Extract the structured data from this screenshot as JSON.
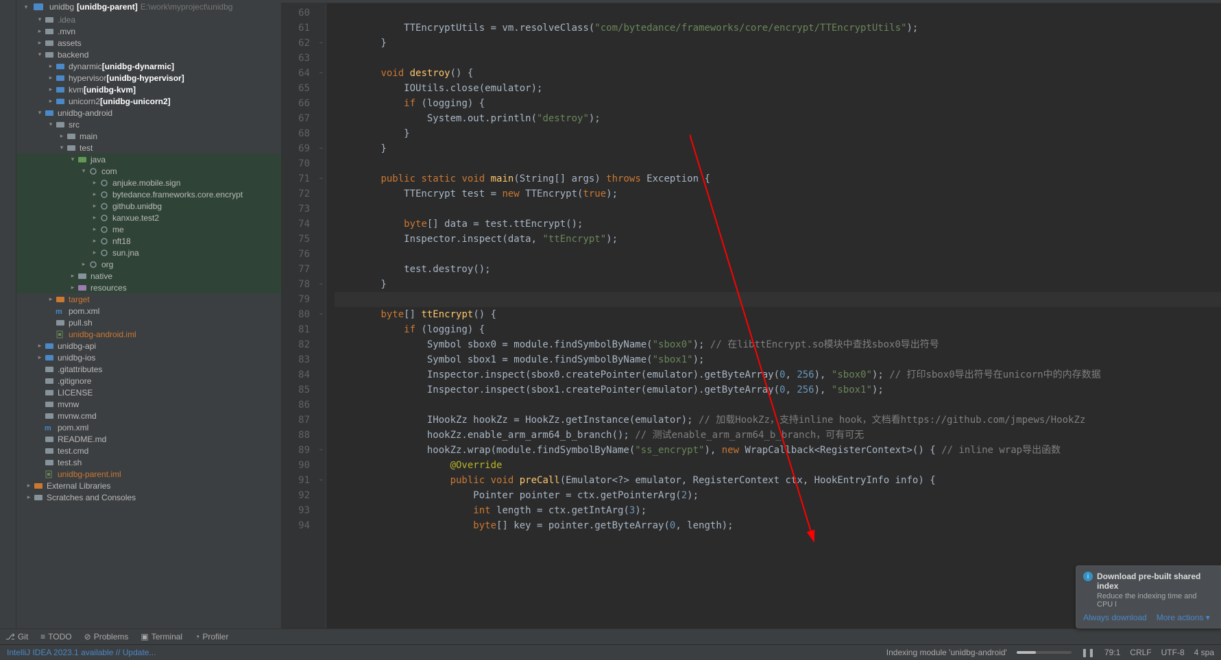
{
  "sidebar": {
    "root": "unidbg",
    "root_mod": "[unidbg-parent]",
    "root_path": "E:\\work\\myproject\\unidbg",
    "items": [
      {
        "d": 1,
        "exp": "▾",
        "ic": "folder",
        "label": ".idea",
        "dim": true
      },
      {
        "d": 1,
        "exp": "▸",
        "ic": "folder",
        "label": ".mvn"
      },
      {
        "d": 1,
        "exp": "▸",
        "ic": "folder",
        "label": "assets"
      },
      {
        "d": 1,
        "exp": "▾",
        "ic": "folder",
        "label": "backend"
      },
      {
        "d": 2,
        "exp": "▸",
        "ic": "mod",
        "label": "dynarmic",
        "mod": "[unidbg-dynarmic]"
      },
      {
        "d": 2,
        "exp": "▸",
        "ic": "mod",
        "label": "hypervisor",
        "mod": "[unidbg-hypervisor]"
      },
      {
        "d": 2,
        "exp": "▸",
        "ic": "mod",
        "label": "kvm",
        "mod": "[unidbg-kvm]"
      },
      {
        "d": 2,
        "exp": "▸",
        "ic": "mod",
        "label": "unicorn2",
        "mod": "[unidbg-unicorn2]"
      },
      {
        "d": 1,
        "exp": "▾",
        "ic": "mod",
        "label": "unidbg-android",
        "module": true
      },
      {
        "d": 2,
        "exp": "▾",
        "ic": "folder",
        "label": "src"
      },
      {
        "d": 3,
        "exp": "▸",
        "ic": "folder",
        "label": "main"
      },
      {
        "d": 3,
        "exp": "▾",
        "ic": "folder",
        "label": "test"
      },
      {
        "d": 4,
        "exp": "▾",
        "ic": "src",
        "label": "java",
        "sel": true
      },
      {
        "d": 5,
        "exp": "▾",
        "ic": "pkg",
        "label": "com",
        "sel": true
      },
      {
        "d": 6,
        "exp": "▸",
        "ic": "pkg",
        "label": "anjuke.mobile.sign",
        "sel": true
      },
      {
        "d": 6,
        "exp": "▸",
        "ic": "pkg",
        "label": "bytedance.frameworks.core.encrypt",
        "sel": true
      },
      {
        "d": 6,
        "exp": "▸",
        "ic": "pkg",
        "label": "github.unidbg",
        "sel": true
      },
      {
        "d": 6,
        "exp": "▸",
        "ic": "pkg",
        "label": "kanxue.test2",
        "sel": true
      },
      {
        "d": 6,
        "exp": "▸",
        "ic": "pkg",
        "label": "me",
        "sel": true
      },
      {
        "d": 6,
        "exp": "▸",
        "ic": "pkg",
        "label": "nft18",
        "sel": true
      },
      {
        "d": 6,
        "exp": "▸",
        "ic": "pkg",
        "label": "sun.jna",
        "sel": true
      },
      {
        "d": 5,
        "exp": "▸",
        "ic": "pkg",
        "label": "org",
        "sel": true
      },
      {
        "d": 4,
        "exp": "▸",
        "ic": "folder",
        "label": "native",
        "sel": true
      },
      {
        "d": 4,
        "exp": "▸",
        "ic": "res",
        "label": "resources",
        "sel": true
      },
      {
        "d": 2,
        "exp": "▸",
        "ic": "target",
        "label": "target",
        "orange": true
      },
      {
        "d": 2,
        "exp": "",
        "ic": "mvn",
        "label": "pom.xml"
      },
      {
        "d": 2,
        "exp": "",
        "ic": "file",
        "label": "pull.sh"
      },
      {
        "d": 2,
        "exp": "",
        "ic": "iml",
        "label": "unidbg-android.iml",
        "orange": true
      },
      {
        "d": 1,
        "exp": "▸",
        "ic": "mod",
        "label": "unidbg-api",
        "module": true
      },
      {
        "d": 1,
        "exp": "▸",
        "ic": "mod",
        "label": "unidbg-ios",
        "module": true
      },
      {
        "d": 1,
        "exp": "",
        "ic": "file",
        "label": ".gitattributes"
      },
      {
        "d": 1,
        "exp": "",
        "ic": "file",
        "label": ".gitignore"
      },
      {
        "d": 1,
        "exp": "",
        "ic": "file",
        "label": "LICENSE"
      },
      {
        "d": 1,
        "exp": "",
        "ic": "file",
        "label": "mvnw"
      },
      {
        "d": 1,
        "exp": "",
        "ic": "file",
        "label": "mvnw.cmd"
      },
      {
        "d": 1,
        "exp": "",
        "ic": "mvn",
        "label": "pom.xml"
      },
      {
        "d": 1,
        "exp": "",
        "ic": "file",
        "label": "README.md"
      },
      {
        "d": 1,
        "exp": "",
        "ic": "file",
        "label": "test.cmd"
      },
      {
        "d": 1,
        "exp": "",
        "ic": "file",
        "label": "test.sh"
      },
      {
        "d": 1,
        "exp": "",
        "ic": "iml",
        "label": "unidbg-parent.iml",
        "orange": true
      },
      {
        "d": 0,
        "exp": "▸",
        "ic": "lib",
        "label": "External Libraries"
      },
      {
        "d": 0,
        "exp": "▸",
        "ic": "scratch",
        "label": "Scratches and Consoles"
      }
    ]
  },
  "editor": {
    "first_line": 60,
    "lines": [
      {
        "n": 60,
        "t": []
      },
      {
        "n": 61,
        "t": [
          {
            "c": "ident",
            "s": "            TTEncryptUtils = vm.resolveClass("
          },
          {
            "c": "str",
            "s": "\"com/bytedance/frameworks/core/encrypt/TTEncryptUtils\""
          },
          {
            "c": "ident",
            "s": ");"
          }
        ]
      },
      {
        "n": 62,
        "fold": "−",
        "t": [
          {
            "c": "ident",
            "s": "        }"
          }
        ]
      },
      {
        "n": 63,
        "t": []
      },
      {
        "n": 64,
        "fold": "−",
        "t": [
          {
            "c": "ident",
            "s": "        "
          },
          {
            "c": "kw",
            "s": "void"
          },
          {
            "c": "ident",
            "s": " "
          },
          {
            "c": "fn",
            "s": "destroy"
          },
          {
            "c": "ident",
            "s": "() {"
          }
        ]
      },
      {
        "n": 65,
        "t": [
          {
            "c": "ident",
            "s": "            IOUtils.close(emulator);"
          }
        ]
      },
      {
        "n": 66,
        "t": [
          {
            "c": "ident",
            "s": "            "
          },
          {
            "c": "kw",
            "s": "if"
          },
          {
            "c": "ident",
            "s": " (logging) {"
          }
        ]
      },
      {
        "n": 67,
        "t": [
          {
            "c": "ident",
            "s": "                System.out.println("
          },
          {
            "c": "str",
            "s": "\"destroy\""
          },
          {
            "c": "ident",
            "s": ");"
          }
        ]
      },
      {
        "n": 68,
        "t": [
          {
            "c": "ident",
            "s": "            }"
          }
        ]
      },
      {
        "n": 69,
        "fold": "−",
        "t": [
          {
            "c": "ident",
            "s": "        }"
          }
        ]
      },
      {
        "n": 70,
        "t": []
      },
      {
        "n": 71,
        "fold": "−",
        "t": [
          {
            "c": "ident",
            "s": "        "
          },
          {
            "c": "kw",
            "s": "public static void"
          },
          {
            "c": "ident",
            "s": " "
          },
          {
            "c": "fn",
            "s": "main"
          },
          {
            "c": "ident",
            "s": "(String[] args) "
          },
          {
            "c": "kw",
            "s": "throws"
          },
          {
            "c": "ident",
            "s": " Exception {"
          }
        ]
      },
      {
        "n": 72,
        "t": [
          {
            "c": "ident",
            "s": "            TTEncrypt test = "
          },
          {
            "c": "kw",
            "s": "new"
          },
          {
            "c": "ident",
            "s": " TTEncrypt("
          },
          {
            "c": "kw",
            "s": "true"
          },
          {
            "c": "ident",
            "s": ");"
          }
        ]
      },
      {
        "n": 73,
        "t": []
      },
      {
        "n": 74,
        "t": [
          {
            "c": "ident",
            "s": "            "
          },
          {
            "c": "kw",
            "s": "byte"
          },
          {
            "c": "ident",
            "s": "[] data = test.ttEncrypt();"
          }
        ]
      },
      {
        "n": 75,
        "t": [
          {
            "c": "ident",
            "s": "            Inspector.inspect(data, "
          },
          {
            "c": "str",
            "s": "\"ttEncrypt\""
          },
          {
            "c": "ident",
            "s": ");"
          }
        ]
      },
      {
        "n": 76,
        "t": []
      },
      {
        "n": 77,
        "t": [
          {
            "c": "ident",
            "s": "            test.destroy();"
          }
        ]
      },
      {
        "n": 78,
        "fold": "−",
        "t": [
          {
            "c": "ident",
            "s": "        }"
          }
        ]
      },
      {
        "n": 79,
        "caret": true,
        "t": []
      },
      {
        "n": 80,
        "fold": "−",
        "t": [
          {
            "c": "ident",
            "s": "        "
          },
          {
            "c": "kw",
            "s": "byte"
          },
          {
            "c": "ident",
            "s": "[] "
          },
          {
            "c": "fn",
            "s": "ttEncrypt"
          },
          {
            "c": "ident",
            "s": "() {"
          }
        ]
      },
      {
        "n": 81,
        "t": [
          {
            "c": "ident",
            "s": "            "
          },
          {
            "c": "kw",
            "s": "if"
          },
          {
            "c": "ident",
            "s": " (logging) {"
          }
        ]
      },
      {
        "n": 82,
        "t": [
          {
            "c": "ident",
            "s": "                Symbol sbox0 = module.findSymbolByName("
          },
          {
            "c": "str",
            "s": "\"sbox0\""
          },
          {
            "c": "ident",
            "s": "); "
          },
          {
            "c": "com",
            "s": "// 在libttEncrypt.so模块中查找sbox0导出符号"
          }
        ]
      },
      {
        "n": 83,
        "t": [
          {
            "c": "ident",
            "s": "                Symbol sbox1 = module.findSymbolByName("
          },
          {
            "c": "str",
            "s": "\"sbox1\""
          },
          {
            "c": "ident",
            "s": ");"
          }
        ]
      },
      {
        "n": 84,
        "t": [
          {
            "c": "ident",
            "s": "                Inspector.inspect(sbox0.createPointer(emulator).getByteArray("
          },
          {
            "c": "num",
            "s": "0"
          },
          {
            "c": "ident",
            "s": ", "
          },
          {
            "c": "num",
            "s": "256"
          },
          {
            "c": "ident",
            "s": "), "
          },
          {
            "c": "str",
            "s": "\"sbox0\""
          },
          {
            "c": "ident",
            "s": "); "
          },
          {
            "c": "com",
            "s": "// 打印sbox0导出符号在unicorn中的内存数据"
          }
        ]
      },
      {
        "n": 85,
        "t": [
          {
            "c": "ident",
            "s": "                Inspector.inspect(sbox1.createPointer(emulator).getByteArray("
          },
          {
            "c": "num",
            "s": "0"
          },
          {
            "c": "ident",
            "s": ", "
          },
          {
            "c": "num",
            "s": "256"
          },
          {
            "c": "ident",
            "s": "), "
          },
          {
            "c": "str",
            "s": "\"sbox1\""
          },
          {
            "c": "ident",
            "s": ");"
          }
        ]
      },
      {
        "n": 86,
        "t": []
      },
      {
        "n": 87,
        "t": [
          {
            "c": "ident",
            "s": "                IHookZz hookZz = HookZz.getInstance(emulator); "
          },
          {
            "c": "com",
            "s": "// 加载HookZz，支持inline hook，文档看https://github.com/jmpews/HookZz"
          }
        ]
      },
      {
        "n": 88,
        "t": [
          {
            "c": "ident",
            "s": "                hookZz.enable_arm_arm64_b_branch(); "
          },
          {
            "c": "com",
            "s": "// 测试enable_arm_arm64_b_branch，可有可无"
          }
        ]
      },
      {
        "n": 89,
        "fold": "−",
        "t": [
          {
            "c": "ident",
            "s": "                hookZz.wrap(module.findSymbolByName("
          },
          {
            "c": "str",
            "s": "\"ss_encrypt\""
          },
          {
            "c": "ident",
            "s": "), "
          },
          {
            "c": "kw",
            "s": "new"
          },
          {
            "c": "ident",
            "s": " WrapCallback<RegisterContext>() { "
          },
          {
            "c": "com",
            "s": "// inline wrap导出函数"
          }
        ]
      },
      {
        "n": 90,
        "t": [
          {
            "c": "ident",
            "s": "                    "
          },
          {
            "c": "ann",
            "s": "@Override"
          }
        ]
      },
      {
        "n": 91,
        "fold": "−",
        "t": [
          {
            "c": "ident",
            "s": "                    "
          },
          {
            "c": "kw",
            "s": "public void"
          },
          {
            "c": "ident",
            "s": " "
          },
          {
            "c": "fn",
            "s": "preCall"
          },
          {
            "c": "ident",
            "s": "(Emulator<?> emulator, RegisterContext ctx, HookEntryInfo info) {"
          }
        ]
      },
      {
        "n": 92,
        "t": [
          {
            "c": "ident",
            "s": "                        Pointer pointer = ctx.getPointerArg("
          },
          {
            "c": "num",
            "s": "2"
          },
          {
            "c": "ident",
            "s": ");"
          }
        ]
      },
      {
        "n": 93,
        "t": [
          {
            "c": "ident",
            "s": "                        "
          },
          {
            "c": "kw",
            "s": "int"
          },
          {
            "c": "ident",
            "s": " length = ctx.getIntArg("
          },
          {
            "c": "num",
            "s": "3"
          },
          {
            "c": "ident",
            "s": ");"
          }
        ]
      },
      {
        "n": 94,
        "t": [
          {
            "c": "ident",
            "s": "                        "
          },
          {
            "c": "kw",
            "s": "byte"
          },
          {
            "c": "ident",
            "s": "[] key = pointer.getByteArray("
          },
          {
            "c": "num",
            "s": "0"
          },
          {
            "c": "ident",
            "s": ", length);"
          }
        ]
      }
    ]
  },
  "bottom_tools": {
    "git": "Git",
    "todo": "TODO",
    "problems": "Problems",
    "terminal": "Terminal",
    "profiler": "Profiler"
  },
  "status": {
    "update": "IntelliJ IDEA 2023.1 available // Update...",
    "indexing": "Indexing module 'unidbg-android'",
    "pos": "79:1",
    "sep": "CRLF",
    "enc": "UTF-8",
    "indent": "4 spa"
  },
  "notif": {
    "title": "Download pre-built shared index",
    "body": "Reduce the indexing time and CPU l",
    "a1": "Always download",
    "a2": "More actions ▾"
  }
}
